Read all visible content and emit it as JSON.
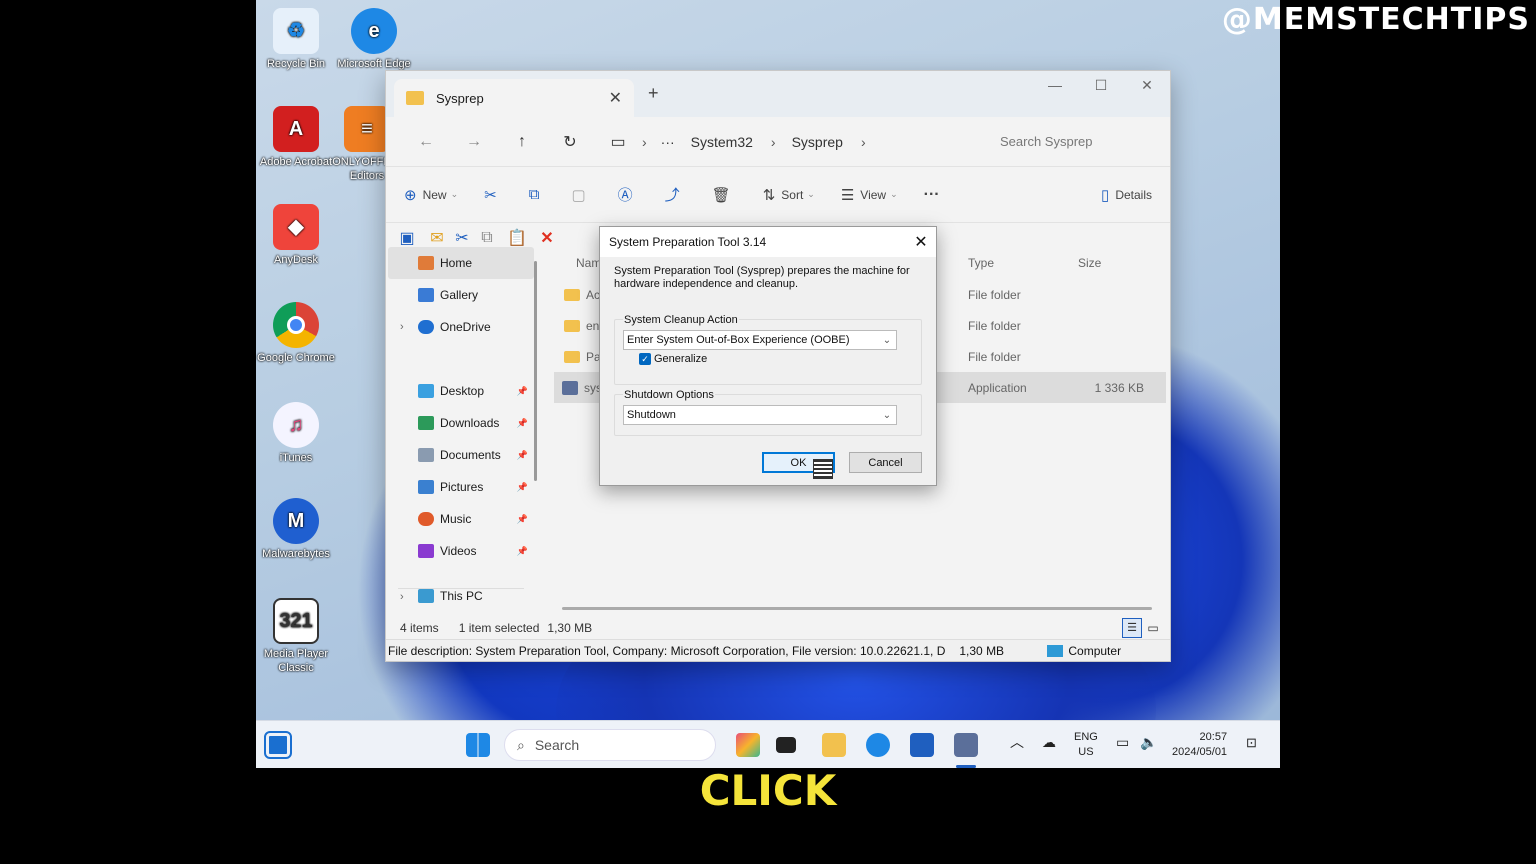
{
  "watermark": "@MEMSTECHTIPS",
  "caption": "CLICK",
  "desktop_icons": [
    {
      "label": "Recycle Bin",
      "color": "#e6f0fa"
    },
    {
      "label": "Microsoft Edge",
      "color": "#1e88e5"
    },
    {
      "label": "Adobe Acrobat",
      "color": "#d21f1f"
    },
    {
      "label": "ONLYOFFICE Editors",
      "color": "#ef7d22"
    },
    {
      "label": "AnyDesk",
      "color": "#ef443b"
    },
    {
      "label": "Google Chrome",
      "color": "#4caf50"
    },
    {
      "label": "iTunes",
      "color": "#e0e0f5"
    },
    {
      "label": "Malwarebytes",
      "color": "#1f5fd0"
    },
    {
      "label": "Media Player Classic",
      "color": "#444444"
    }
  ],
  "explorer": {
    "tab_title": "Sysprep",
    "new_tab": "+",
    "window_controls": {
      "minimize": "—",
      "maximize": "☐",
      "close": "✕"
    },
    "nav": {
      "back": "←",
      "forward": "→",
      "up": "↑",
      "refresh": "↻",
      "more": "···"
    },
    "breadcrumb": [
      "System32",
      "Sysprep"
    ],
    "search_placeholder": "Search Sysprep",
    "commands": {
      "new": "New",
      "sort": "Sort",
      "view": "View",
      "more": "···",
      "details": "Details"
    },
    "sidebar": [
      {
        "label": "Home",
        "color": "#e07b39"
      },
      {
        "label": "Gallery",
        "color": "#3a7bd5"
      },
      {
        "label": "OneDrive",
        "color": "#1f6fd1"
      },
      {
        "label": "Desktop",
        "color": "#3aa0e0"
      },
      {
        "label": "Downloads",
        "color": "#2c9a5a"
      },
      {
        "label": "Documents",
        "color": "#8a9bb0"
      },
      {
        "label": "Pictures",
        "color": "#3a80d0"
      },
      {
        "label": "Music",
        "color": "#e05a2a"
      },
      {
        "label": "Videos",
        "color": "#8a3ad0"
      },
      {
        "label": "This PC",
        "color": "#3a9ad0"
      }
    ],
    "columns": {
      "name": "Nam",
      "type": "Type",
      "size": "Size"
    },
    "rows": [
      {
        "name": "Ac",
        "type": "File folder",
        "size": ""
      },
      {
        "name": "en",
        "type": "File folder",
        "size": ""
      },
      {
        "name": "Pa",
        "type": "File folder",
        "size": ""
      },
      {
        "name": "sys",
        "type": "Application",
        "size": "1 336 KB"
      }
    ],
    "status": {
      "items": "4 items",
      "selected": "1 item selected",
      "size": "1,30 MB"
    },
    "infobar": {
      "text": "File description: System Preparation Tool, Company: Microsoft Corporation, File version: 10.0.22621.1, D",
      "size": "1,30 MB",
      "location": "Computer"
    }
  },
  "dialog": {
    "title": "System Preparation Tool 3.14",
    "close": "✕",
    "description": "System Preparation Tool (Sysprep) prepares the machine for hardware independence and cleanup.",
    "cleanup_group": "System Cleanup Action",
    "cleanup_value": "Enter System Out-of-Box Experience (OOBE)",
    "generalize_label": "Generalize",
    "generalize_checked": true,
    "shutdown_group": "Shutdown Options",
    "shutdown_value": "Shutdown",
    "ok": "OK",
    "cancel": "Cancel"
  },
  "taskbar": {
    "search_placeholder": "Search",
    "lang": "ENG",
    "region": "US",
    "time": "20:57",
    "date": "2024/05/01"
  }
}
